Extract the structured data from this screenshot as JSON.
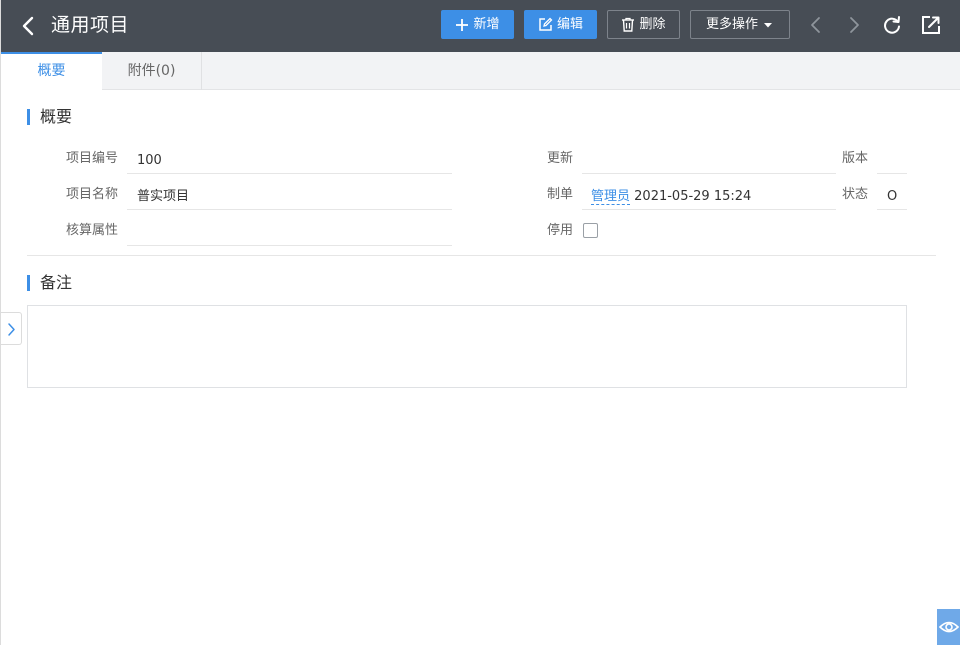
{
  "header": {
    "title": "通用项目",
    "buttons": {
      "add": "新增",
      "edit": "编辑",
      "delete": "删除",
      "more": "更多操作"
    }
  },
  "tabs": [
    {
      "label": "概要"
    },
    {
      "label": "附件(0)"
    }
  ],
  "overview": {
    "title": "概要",
    "fields": {
      "code_label": "项目编号",
      "code_value": "100",
      "name_label": "项目名称",
      "name_value": "普实项目",
      "accounting_label": "核算属性",
      "accounting_value": "",
      "update_label": "更新",
      "update_value": "",
      "creator_label": "制单",
      "creator_user": "管理员",
      "creator_time": "2021-05-29 15:24",
      "disabled_label": "停用",
      "version_label": "版本",
      "version_value": "",
      "status_label": "状态",
      "status_value": "O"
    }
  },
  "remark": {
    "title": "备注",
    "value": ""
  },
  "colors": {
    "header_bg": "#474d55",
    "accent": "#3d8fe6"
  }
}
